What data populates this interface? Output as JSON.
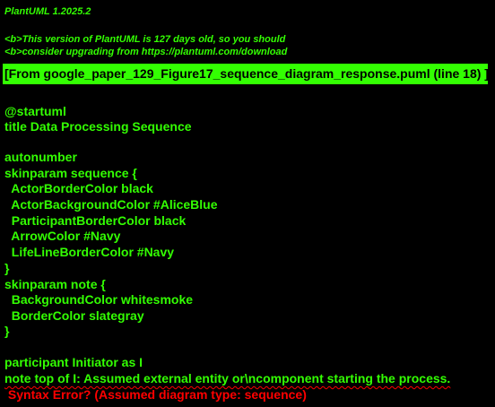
{
  "header": {
    "version": "PlantUML 1.2025.2",
    "warning_line_1": "<b>This version of PlantUML is 127 days old, so you should",
    "warning_line_2": "<b>consider upgrading from https://plantuml.com/download"
  },
  "banner": {
    "text": "[From google_paper_129_Figure17_sequence_diagram_response.puml (line 18) ]"
  },
  "source_lines": [
    "@startuml",
    "title Data Processing Sequence",
    "",
    "autonumber",
    "skinparam sequence {",
    "  ActorBorderColor black",
    "  ActorBackgroundColor #AliceBlue",
    "  ParticipantBorderColor black",
    "  ArrowColor #Navy",
    "  LifeLineBorderColor #Navy",
    "}",
    "skinparam note {",
    "  BackgroundColor whitesmoke",
    "  BorderColor slategray",
    "}",
    "",
    "participant Initiator as I",
    "note top of I: Assumed external entity or\\ncomponent starting the process."
  ],
  "error": {
    "message": " Syntax Error? (Assumed diagram type: sequence)"
  },
  "colors": {
    "background": "#000000",
    "text": "#33ff02",
    "banner_background": "#33ff02",
    "banner_text": "#000000",
    "error": "#ff0000"
  }
}
